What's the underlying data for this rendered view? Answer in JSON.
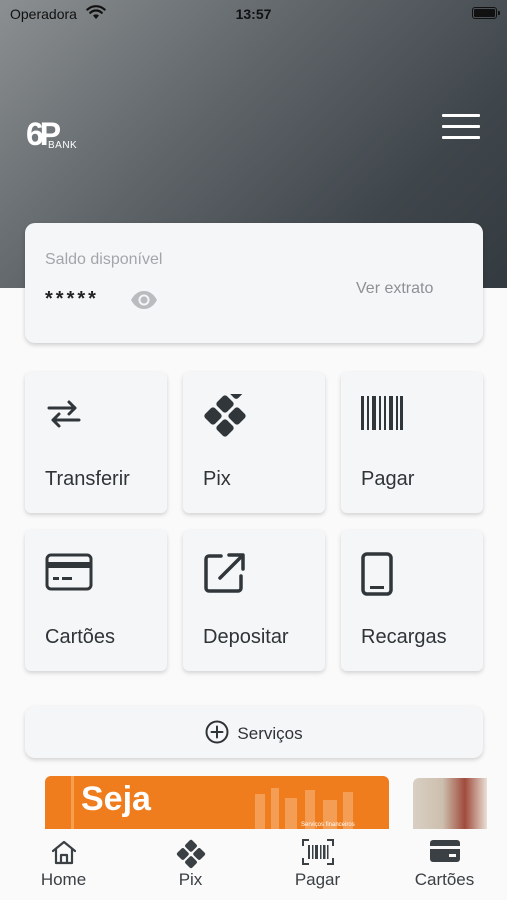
{
  "status_bar": {
    "carrier": "Operadora",
    "time": "13:57"
  },
  "brand": {
    "logo_mark": "6P",
    "logo_sub": "BANK"
  },
  "balance": {
    "label": "Saldo disponível",
    "masked_value": "*****",
    "statement_link": "Ver extrato"
  },
  "actions": [
    {
      "label": "Transferir",
      "icon": "transfer-arrows-icon"
    },
    {
      "label": "Pix",
      "icon": "pix-icon"
    },
    {
      "label": "Pagar",
      "icon": "barcode-icon"
    },
    {
      "label": "Cartões",
      "icon": "credit-card-icon"
    },
    {
      "label": "Depositar",
      "icon": "external-link-icon"
    },
    {
      "label": "Recargas",
      "icon": "smartphone-icon"
    }
  ],
  "services": {
    "label": "Serviços",
    "icon": "plus-circle-icon"
  },
  "banner": {
    "headline": "Seja",
    "small_text": "Serviços financeiros"
  },
  "tabs": [
    {
      "label": "Home",
      "icon": "home-icon"
    },
    {
      "label": "Pix",
      "icon": "pix-icon"
    },
    {
      "label": "Pagar",
      "icon": "barcode-scan-icon"
    },
    {
      "label": "Cartões",
      "icon": "card-icon"
    }
  ],
  "colors": {
    "header_dark": "#343b40",
    "accent_banner": "#ef7d1d",
    "card_bg": "#f5f6f8",
    "icon_dark": "#30363a"
  }
}
